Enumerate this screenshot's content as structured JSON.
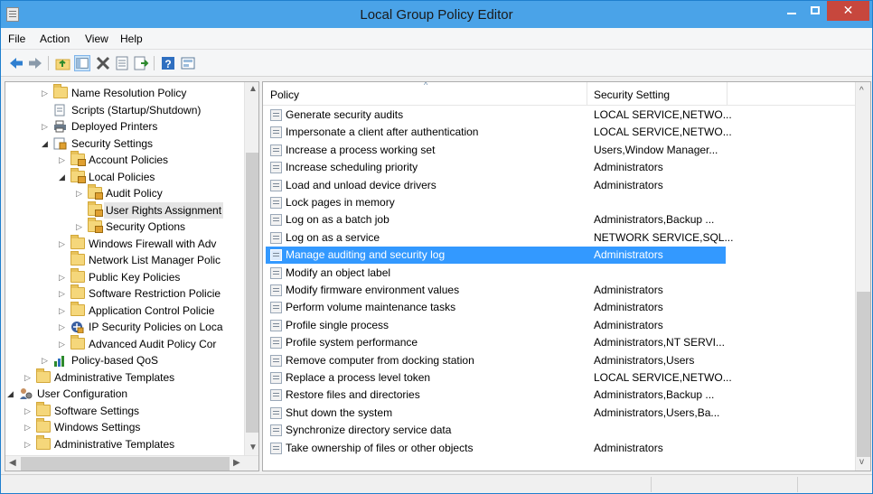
{
  "window": {
    "title": "Local Group Policy Editor"
  },
  "menu": [
    "File",
    "Action",
    "View",
    "Help"
  ],
  "toolbar": {
    "buttons": [
      "back-arrow-icon",
      "forward-arrow-icon",
      "up-folder-icon",
      "show-hide-tree-icon",
      "delete-icon",
      "properties-icon",
      "export-list-icon",
      "help-icon",
      "filter-options-icon"
    ]
  },
  "tree": [
    {
      "label": "Name Resolution Policy",
      "indent": 3,
      "expander": "collapsed",
      "icon": "folder"
    },
    {
      "label": "Scripts (Startup/Shutdown)",
      "indent": 3,
      "expander": "",
      "icon": "script"
    },
    {
      "label": "Deployed Printers",
      "indent": 3,
      "expander": "collapsed",
      "icon": "printer"
    },
    {
      "label": "Security Settings",
      "indent": 3,
      "expander": "expanded",
      "icon": "security"
    },
    {
      "label": "Account Policies",
      "indent": 4,
      "expander": "collapsed",
      "icon": "folder-lock"
    },
    {
      "label": "Local Policies",
      "indent": 4,
      "expander": "expanded",
      "icon": "folder-lock"
    },
    {
      "label": "Audit Policy",
      "indent": 5,
      "expander": "collapsed",
      "icon": "folder-lock"
    },
    {
      "label": "User Rights Assignment",
      "indent": 5,
      "expander": "",
      "icon": "folder-lock",
      "selected": true
    },
    {
      "label": "Security Options",
      "indent": 5,
      "expander": "collapsed",
      "icon": "folder-lock"
    },
    {
      "label": "Windows Firewall with Adv",
      "indent": 4,
      "expander": "collapsed",
      "icon": "folder"
    },
    {
      "label": "Network List Manager Polic",
      "indent": 4,
      "expander": "",
      "icon": "folder"
    },
    {
      "label": "Public Key Policies",
      "indent": 4,
      "expander": "collapsed",
      "icon": "folder"
    },
    {
      "label": "Software Restriction Policie",
      "indent": 4,
      "expander": "collapsed",
      "icon": "folder"
    },
    {
      "label": "Application Control Policie",
      "indent": 4,
      "expander": "collapsed",
      "icon": "folder"
    },
    {
      "label": "IP Security Policies on Loca",
      "indent": 4,
      "expander": "collapsed",
      "icon": "ipsec"
    },
    {
      "label": "Advanced Audit Policy Cor",
      "indent": 4,
      "expander": "collapsed",
      "icon": "folder"
    },
    {
      "label": "Policy-based QoS",
      "indent": 3,
      "expander": "collapsed",
      "icon": "qos"
    },
    {
      "label": "Administrative Templates",
      "indent": 2,
      "expander": "collapsed",
      "icon": "folder"
    },
    {
      "label": "User Configuration",
      "indent": 1,
      "expander": "expanded",
      "icon": "user-config"
    },
    {
      "label": "Software Settings",
      "indent": 2,
      "expander": "collapsed",
      "icon": "folder"
    },
    {
      "label": "Windows Settings",
      "indent": 2,
      "expander": "collapsed",
      "icon": "folder"
    },
    {
      "label": "Administrative Templates",
      "indent": 2,
      "expander": "collapsed",
      "icon": "folder"
    }
  ],
  "list": {
    "columns": [
      "Policy",
      "Security Setting"
    ],
    "rows": [
      {
        "policy": "Generate security audits",
        "setting": "LOCAL SERVICE,NETWO..."
      },
      {
        "policy": "Impersonate a client after authentication",
        "setting": "LOCAL SERVICE,NETWO..."
      },
      {
        "policy": "Increase a process working set",
        "setting": "Users,Window Manager..."
      },
      {
        "policy": "Increase scheduling priority",
        "setting": "Administrators"
      },
      {
        "policy": "Load and unload device drivers",
        "setting": "Administrators"
      },
      {
        "policy": "Lock pages in memory",
        "setting": ""
      },
      {
        "policy": "Log on as a batch job",
        "setting": "Administrators,Backup ..."
      },
      {
        "policy": "Log on as a service",
        "setting": "NETWORK SERVICE,SQL..."
      },
      {
        "policy": "Manage auditing and security log",
        "setting": "Administrators",
        "selected": true
      },
      {
        "policy": "Modify an object label",
        "setting": ""
      },
      {
        "policy": "Modify firmware environment values",
        "setting": "Administrators"
      },
      {
        "policy": "Perform volume maintenance tasks",
        "setting": "Administrators"
      },
      {
        "policy": "Profile single process",
        "setting": "Administrators"
      },
      {
        "policy": "Profile system performance",
        "setting": "Administrators,NT SERVI..."
      },
      {
        "policy": "Remove computer from docking station",
        "setting": "Administrators,Users"
      },
      {
        "policy": "Replace a process level token",
        "setting": "LOCAL SERVICE,NETWO..."
      },
      {
        "policy": "Restore files and directories",
        "setting": "Administrators,Backup ..."
      },
      {
        "policy": "Shut down the system",
        "setting": "Administrators,Users,Ba..."
      },
      {
        "policy": "Synchronize directory service data",
        "setting": ""
      },
      {
        "policy": "Take ownership of files or other objects",
        "setting": "Administrators"
      }
    ]
  },
  "colors": {
    "titlebar": "#4aa3e8",
    "close": "#c7473d",
    "selection": "#3399ff"
  }
}
